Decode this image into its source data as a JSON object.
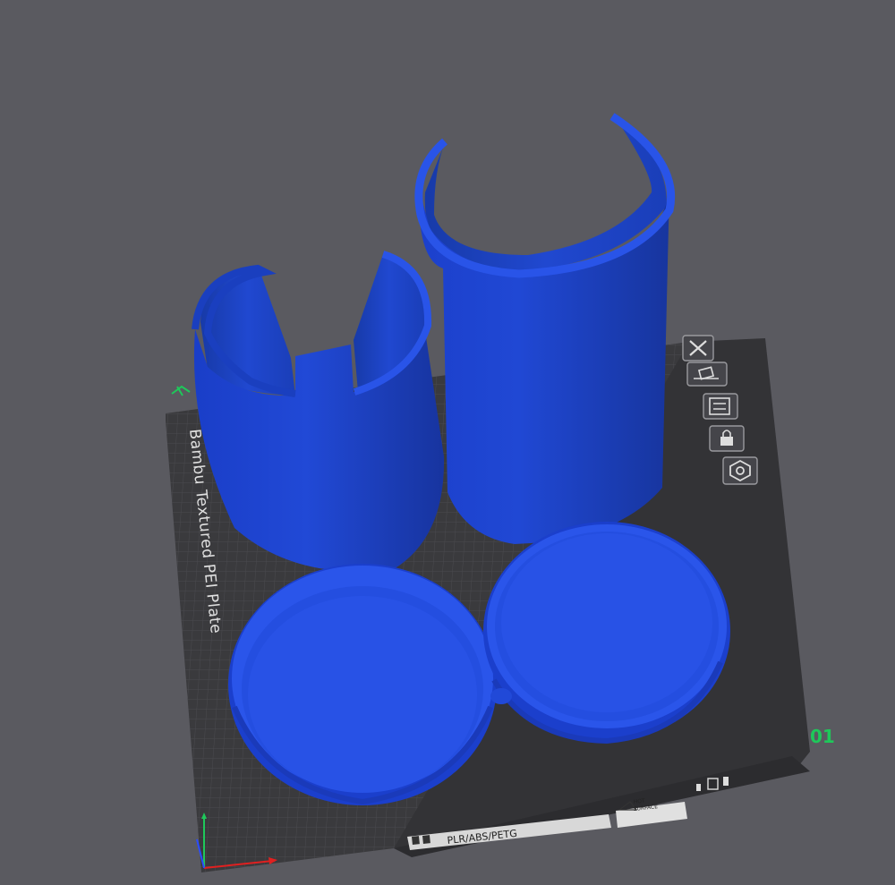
{
  "plate": {
    "name_label": "Bambu Textured PEI Plate",
    "number_label": "01",
    "material_label": "PLR/ABS/PETG",
    "hot_surface_line1": "HOT",
    "hot_surface_line2": "SURFACE"
  },
  "plate_toolbar": {
    "items": [
      {
        "icon": "close-icon"
      },
      {
        "icon": "auto-orient-icon"
      },
      {
        "icon": "arrange-icon"
      },
      {
        "icon": "lock-icon"
      },
      {
        "icon": "settings-gear-icon"
      }
    ]
  },
  "colors": {
    "background": "#5a5a60",
    "plate": "#3a3a3d",
    "grid_line": "#4a4a4e",
    "model": "#2048d8",
    "plate_number": "#1ec85a"
  },
  "axes": [
    "x-axis",
    "y-axis",
    "z-axis"
  ]
}
